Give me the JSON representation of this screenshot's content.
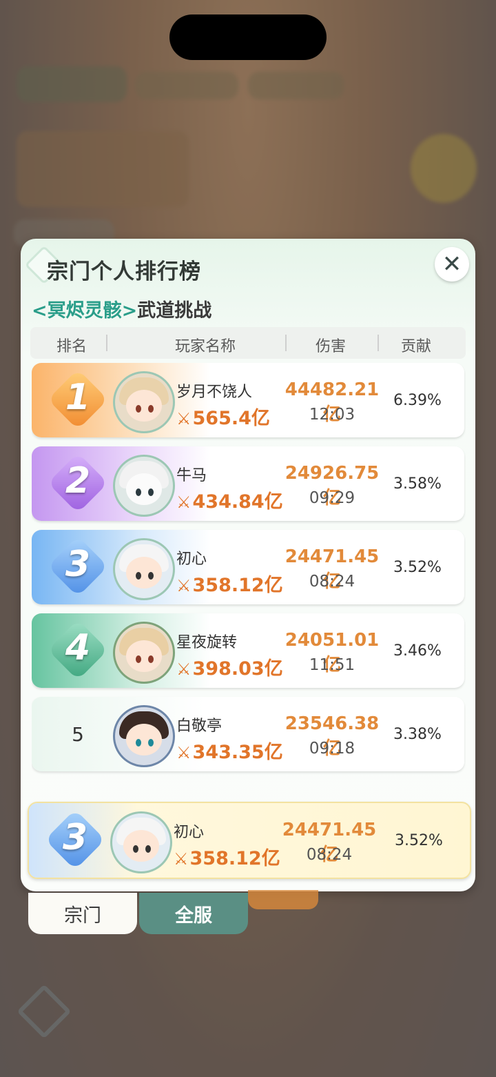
{
  "panel": {
    "title": "宗门个人排行榜",
    "subtitle_event": "<冥烬灵骸>",
    "subtitle_mode": "武道挑战",
    "close_icon": "✕"
  },
  "columns": {
    "rank": "排名",
    "name": "玩家名称",
    "damage": "伤害",
    "contribution": "贡献"
  },
  "rows": [
    {
      "rank": "1",
      "name": "岁月不饶人",
      "power": "565.4亿",
      "damage": "44482.21亿",
      "time": "12:03",
      "contribution": "6.39%"
    },
    {
      "rank": "2",
      "name": "牛马",
      "power": "434.84亿",
      "damage": "24926.75亿",
      "time": "09:29",
      "contribution": "3.58%"
    },
    {
      "rank": "3",
      "name": "初心",
      "power": "358.12亿",
      "damage": "24471.45亿",
      "time": "08:24",
      "contribution": "3.52%"
    },
    {
      "rank": "4",
      "name": "星夜旋转",
      "power": "398.03亿",
      "damage": "24051.01亿",
      "time": "11:51",
      "contribution": "3.46%"
    },
    {
      "rank": "5",
      "name": "白敬亭",
      "power": "343.35亿",
      "damage": "23546.38亿",
      "time": "09:18",
      "contribution": "3.38%"
    }
  ],
  "my_rank": {
    "rank": "3",
    "name": "初心",
    "power": "358.12亿",
    "damage": "24471.45亿",
    "time": "08:24",
    "contribution": "3.52%"
  },
  "tabs": {
    "sect": "宗门",
    "all_server": "全服"
  },
  "icons": {
    "power": "crossed-swords-icon",
    "close": "close-icon"
  },
  "colors": {
    "rank1": "#f6a24a",
    "rank2": "#b07ae6",
    "rank3": "#5aa3ee",
    "rank4": "#4fba93",
    "accent_orange": "#e1752a",
    "tab_active": "#5a8f84"
  }
}
